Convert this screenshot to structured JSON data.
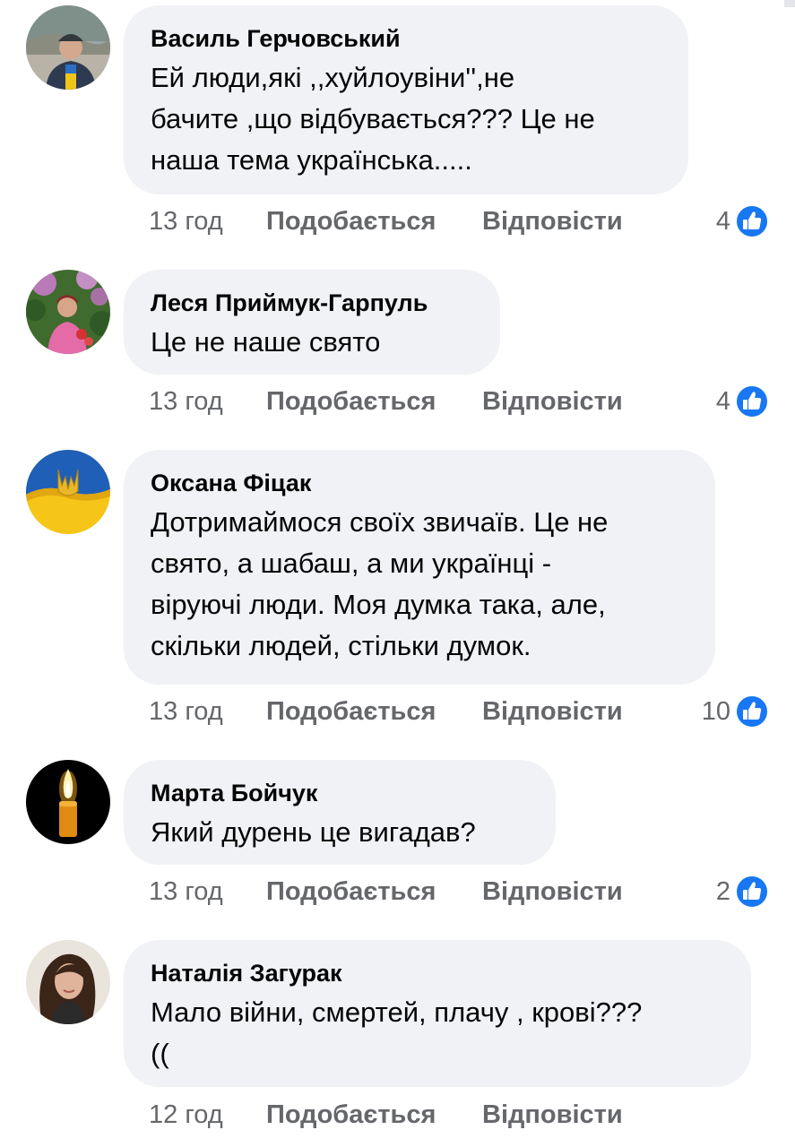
{
  "comments": [
    {
      "author": "Василь Герчовський",
      "lines": [
        "Ей люди,які ,,хуйлоувіни'',не",
        "бачите ,що відбувається??? Це не",
        "наша тема українська....."
      ],
      "time": "13 год",
      "like_label": "Подобається",
      "reply_label": "Відповісти",
      "reactions": "4"
    },
    {
      "author": "Леся Приймук-Гарпуль",
      "lines": [
        "Це не наше свято"
      ],
      "time": "13 год",
      "like_label": "Подобається",
      "reply_label": "Відповісти",
      "reactions": "4"
    },
    {
      "author": "Оксана Фіцак",
      "lines": [
        "Дотримаймося своїх звичаїв. Це не",
        "свято, а шабаш,  а ми українці -",
        "віруючі люди. Моя думка така, але,",
        "скільки людей, стільки думок."
      ],
      "time": "13 год",
      "like_label": "Подобається",
      "reply_label": "Відповісти",
      "reactions": "10"
    },
    {
      "author": "Марта Бойчук",
      "lines": [
        "Який дурень це вигадав?"
      ],
      "time": "13 год",
      "like_label": "Подобається",
      "reply_label": "Відповісти",
      "reactions": "2"
    },
    {
      "author": "Наталія Загурак",
      "lines": [
        "Мало війни, смертей, плачу , крові???",
        "(("
      ],
      "time": "12 год",
      "like_label": "Подобається",
      "reply_label": "Відповісти"
    }
  ],
  "colors": {
    "bubble": "#f0f2f5",
    "meta_text": "#65676b",
    "like_blue": "#1877f2"
  }
}
